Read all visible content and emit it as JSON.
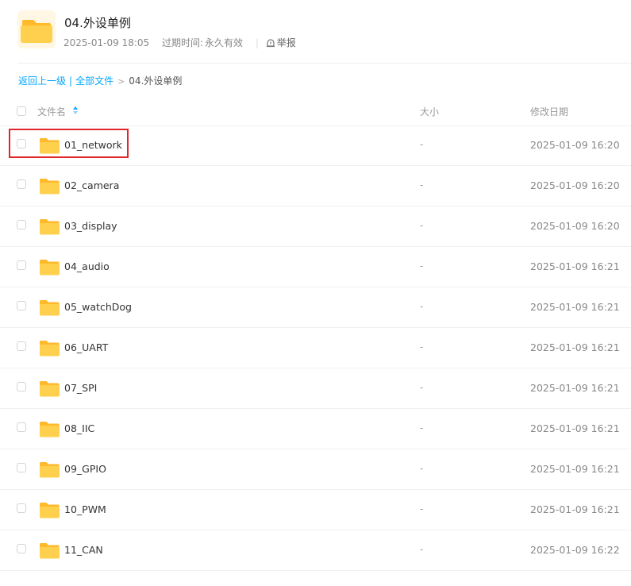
{
  "header": {
    "title": "04.外设单例",
    "date": "2025-01-09 18:05",
    "expire_label": "过期时间:",
    "expire_value": "永久有效",
    "report_label": "举报"
  },
  "breadcrumb": {
    "back": "返回上一级",
    "all_files": "全部文件",
    "current": "04.外设单例"
  },
  "table": {
    "col_name": "文件名",
    "col_size": "大小",
    "col_date": "修改日期",
    "rows": [
      {
        "name": "01_network",
        "size": "-",
        "date": "2025-01-09 16:20"
      },
      {
        "name": "02_camera",
        "size": "-",
        "date": "2025-01-09 16:20"
      },
      {
        "name": "03_display",
        "size": "-",
        "date": "2025-01-09 16:20"
      },
      {
        "name": "04_audio",
        "size": "-",
        "date": "2025-01-09 16:21"
      },
      {
        "name": "05_watchDog",
        "size": "-",
        "date": "2025-01-09 16:21"
      },
      {
        "name": "06_UART",
        "size": "-",
        "date": "2025-01-09 16:21"
      },
      {
        "name": "07_SPI",
        "size": "-",
        "date": "2025-01-09 16:21"
      },
      {
        "name": "08_IIC",
        "size": "-",
        "date": "2025-01-09 16:21"
      },
      {
        "name": "09_GPIO",
        "size": "-",
        "date": "2025-01-09 16:21"
      },
      {
        "name": "10_PWM",
        "size": "-",
        "date": "2025-01-09 16:21"
      },
      {
        "name": "11_CAN",
        "size": "-",
        "date": "2025-01-09 16:22"
      }
    ]
  },
  "colors": {
    "accent": "#06a7ff",
    "folder": "#ffc93c",
    "highlight": "#e0262c"
  },
  "icons": {
    "folder": "folder-icon",
    "report": "warning-icon",
    "sort": "sort-icon"
  }
}
